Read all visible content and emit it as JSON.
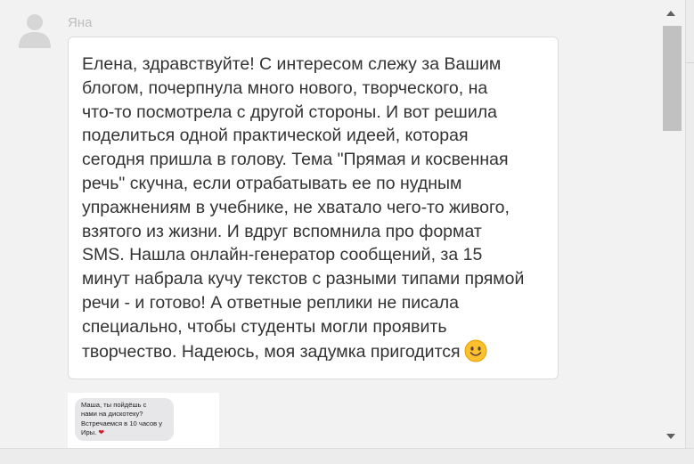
{
  "comment": {
    "author": "Яна",
    "avatar_icon": "user-silhouette-icon",
    "text": "Елена, здравствуйте! С интересом слежу за Вашим\nблогом, почерпнула много нового, творческого, на\nчто-то посмотрела с другой стороны. И вот решила\nподелиться одной практической идеей, которая\nсегодня пришла в голову. Тема \"Прямая и косвенная\nречь\" скучна, если отрабатывать ее по нудным\nупражнениям в учебнике, не хватало чего-то живого,\nвзятого из жизни. И вдруг вспомнила про формат\nSMS. Нашла онлайн-генератор сообщений, за 15\nминут набрала кучу текстов с разными типами прямой\nречи - и готово! А ответные реплики не писала\nспециально, чтобы студенты могли проявить\nтворчество. Надеюсь, моя задумка пригодится",
    "emoji_icon": "smiling-face-emoji-icon",
    "attachment": {
      "sms_text": "Маша, ты пойдёшь с\nнами на дискотеку?\nВстречаемся в 10 часов у\nИры.",
      "heart_glyph": "❤"
    }
  },
  "colors": {
    "author": "#bdbdbd",
    "text": "#333333",
    "bubble_bg": "#ffffff",
    "page_bg": "#f2f2f2",
    "sms_bg": "#e7e7e9",
    "heart": "#d0202a"
  }
}
